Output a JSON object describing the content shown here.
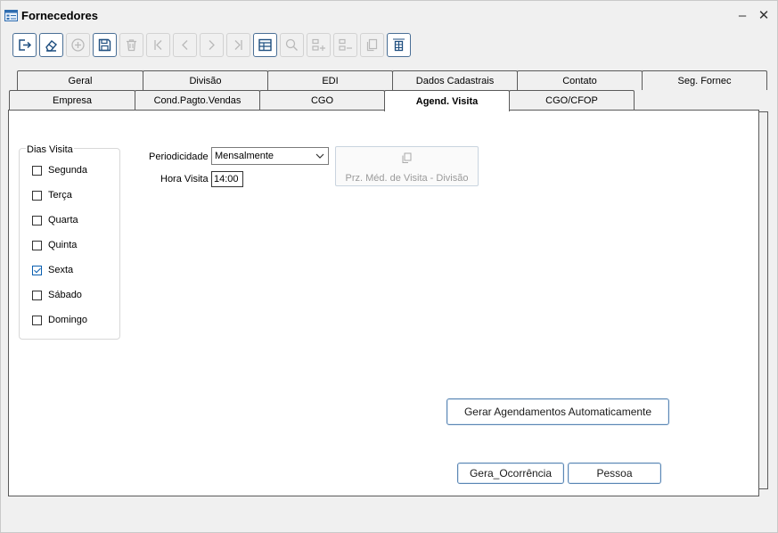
{
  "window": {
    "title": "Fornecedores",
    "minimize_glyph": "–",
    "close_glyph": "✕"
  },
  "toolbar": {
    "buttons": [
      {
        "icon": "exit-icon",
        "state": "active"
      },
      {
        "icon": "eraser-icon",
        "state": "active"
      },
      {
        "icon": "add-circle-icon",
        "state": "disabled"
      },
      {
        "icon": "save-icon",
        "state": "active"
      },
      {
        "icon": "trash-icon",
        "state": "disabled"
      },
      {
        "icon": "first-record-icon",
        "state": "disabled"
      },
      {
        "icon": "previous-record-icon",
        "state": "disabled"
      },
      {
        "icon": "next-record-icon",
        "state": "disabled"
      },
      {
        "icon": "last-record-icon",
        "state": "disabled"
      },
      {
        "icon": "grid-icon",
        "state": "active"
      },
      {
        "icon": "search-icon",
        "state": "disabled"
      },
      {
        "icon": "add-row-icon",
        "state": "disabled"
      },
      {
        "icon": "remove-row-icon",
        "state": "disabled"
      },
      {
        "icon": "copy-icon",
        "state": "disabled"
      },
      {
        "icon": "column-adjust-icon",
        "state": "active"
      }
    ]
  },
  "tabs": {
    "row_top": [
      "Geral",
      "Divisão",
      "EDI",
      "Dados Cadastrais",
      "Contato",
      "Seg. Fornec"
    ],
    "row_bottom": [
      "Empresa",
      "Cond.Pagto.Vendas",
      "CGO",
      "Agend. Visita",
      "CGO/CFOP"
    ],
    "selected": "Agend. Visita"
  },
  "dias_visita": {
    "title": "Dias Visita",
    "days": [
      {
        "label": "Segunda",
        "checked": false
      },
      {
        "label": "Terça",
        "checked": false
      },
      {
        "label": "Quarta",
        "checked": false
      },
      {
        "label": "Quinta",
        "checked": false
      },
      {
        "label": "Sexta",
        "checked": true
      },
      {
        "label": "Sábado",
        "checked": false
      },
      {
        "label": "Domingo",
        "checked": false
      }
    ]
  },
  "form": {
    "periodicidade_label": "Periodicidade",
    "periodicidade_value": "Mensalmente",
    "hora_visita_label": "Hora Visita",
    "hora_visita_value": "14:00",
    "prz_button_label": "Prz. Méd. de Visita - Divisão"
  },
  "actions": {
    "gerar_label": "Gerar Agendamentos Automaticamente",
    "gera_ocorrencia_label": "Gera_Ocorrência",
    "pessoa_label": "Pessoa"
  },
  "colors": {
    "accent": "#0a5fb0",
    "button_border": "#5a86b4",
    "disabled_text": "#9a9a9a"
  }
}
